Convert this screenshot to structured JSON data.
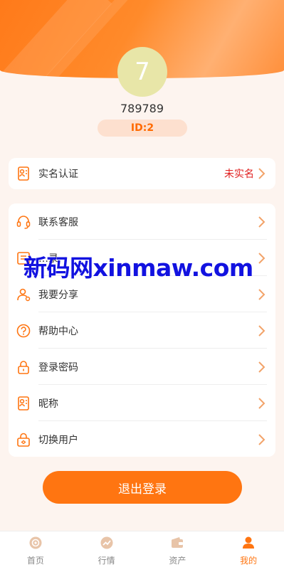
{
  "profile": {
    "avatar_text": "7",
    "username": "789789",
    "id_label": "ID:2"
  },
  "verification": {
    "label": "实名认证",
    "status": "未实名",
    "icon": "id-card-icon"
  },
  "menu": {
    "items": [
      {
        "label": "联系客服",
        "icon": "headset-icon"
      },
      {
        "label": "…录",
        "icon": "record-icon"
      },
      {
        "label": "我要分享",
        "icon": "share-user-icon"
      },
      {
        "label": "帮助中心",
        "icon": "help-icon"
      },
      {
        "label": "登录密码",
        "icon": "lock-icon"
      },
      {
        "label": "昵称",
        "icon": "id-card-icon"
      },
      {
        "label": "切换用户",
        "icon": "switch-lock-icon"
      }
    ]
  },
  "watermark": "新码网xinmaw.com",
  "logout_label": "退出登录",
  "tabbar": {
    "tabs": [
      {
        "label": "首页",
        "icon": "home-icon",
        "active": false
      },
      {
        "label": "行情",
        "icon": "market-icon",
        "active": false
      },
      {
        "label": "资产",
        "icon": "wallet-icon",
        "active": false
      },
      {
        "label": "我的",
        "icon": "user-icon",
        "active": true
      }
    ]
  },
  "colors": {
    "accent": "#ff7511",
    "warning_text": "#e02020",
    "id_badge_bg": "#fde0cf",
    "avatar_bg": "#e8e6a8",
    "watermark": "#1212e0"
  }
}
